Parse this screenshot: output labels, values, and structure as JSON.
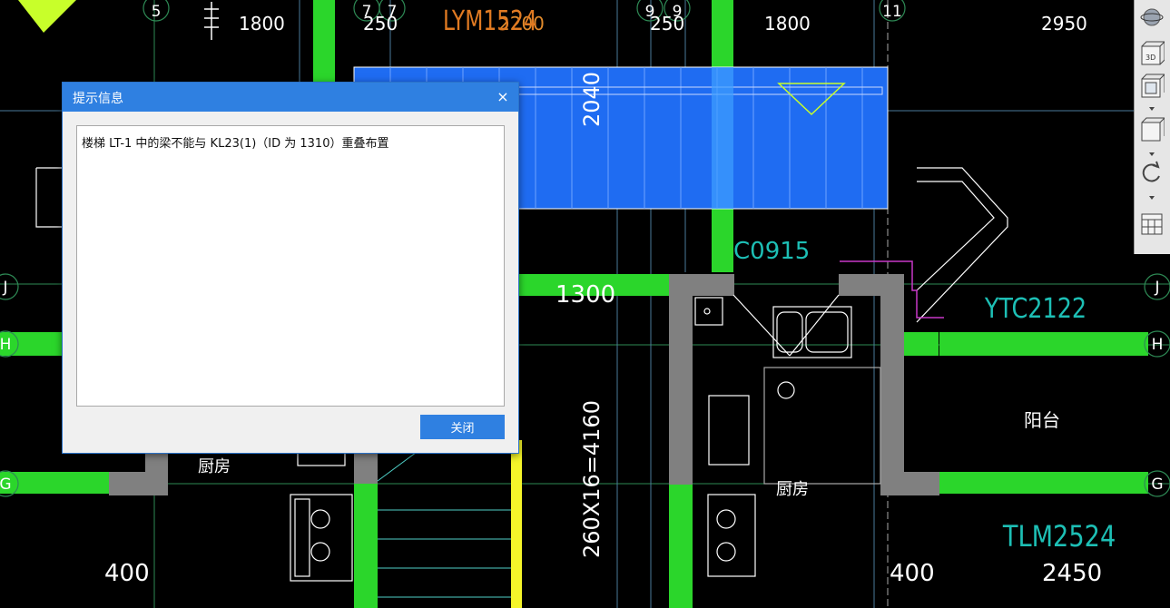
{
  "dialog": {
    "title": "提示信息",
    "message": "楼梯 LT-1 中的梁不能与 KL23(1)（ID 为 1310）重叠布置",
    "close_button": "关闭",
    "close_glyph": "×"
  },
  "drawing": {
    "axis_top": [
      "5",
      "7",
      "7",
      "9",
      "9",
      "11"
    ],
    "axis_left": [
      "J",
      "H",
      "G"
    ],
    "axis_right": [
      "J",
      "H",
      "G"
    ],
    "dimensions_top": [
      "1800",
      "250",
      "2200",
      "250",
      "1800",
      "2950"
    ],
    "dims": {
      "d1300": "1300",
      "d2040": "2040",
      "d_stair": "260X16=4160",
      "d400_left": "400",
      "d400_right": "400",
      "d2450": "2450"
    },
    "labels": {
      "lym": "LYM1524",
      "c0915": "C0915",
      "ytc": "YTC2122",
      "tlm": "TLM2524",
      "kitchen_left": "厨房",
      "kitchen_right": "厨房",
      "balcony": "阳台"
    },
    "colors": {
      "background": "#000000",
      "beam_green": "#2bd62b",
      "stair_blue": "#1f6cf2",
      "wall_gray": "#808080",
      "dialog_accent": "#2f80e1"
    }
  },
  "toolbar": {
    "icons": [
      "orbit-icon",
      "view-3d-icon",
      "view-cube-icon",
      "view-box-icon",
      "rotate-icon",
      "layer-grid-icon"
    ],
    "label_3d": "3D"
  }
}
